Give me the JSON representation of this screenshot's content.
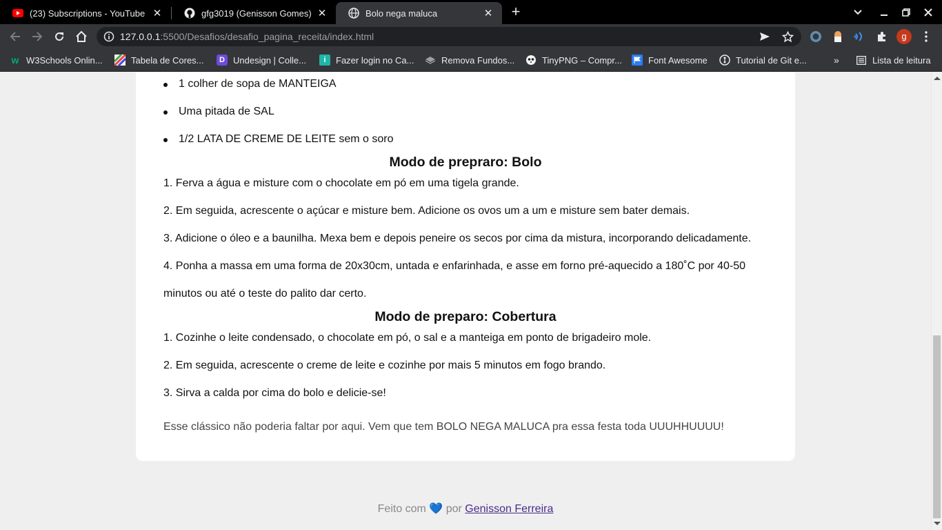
{
  "browser": {
    "tabs": [
      {
        "title": "(23) Subscriptions - YouTube",
        "icon": "youtube-icon",
        "active": false
      },
      {
        "title": "gfg3019 (Genisson Gomes)",
        "icon": "github-icon",
        "active": false
      },
      {
        "title": "Bolo nega maluca",
        "icon": "globe-icon",
        "active": true
      }
    ],
    "new_tab": "+",
    "close": "✕",
    "address": {
      "host": "127.0.0.1",
      "path": ":5500/Desafios/desafio_pagina_receita/index.html"
    },
    "avatar_letter": "g",
    "bookmarks": [
      {
        "label": "W3Schools Onlin...",
        "icon": "w3schools-icon"
      },
      {
        "label": "Tabela de Cores...",
        "icon": "colors-icon"
      },
      {
        "label": "Undesign | Colle...",
        "icon": "undesign-icon"
      },
      {
        "label": "Fazer login no Ca...",
        "icon": "canva-icon"
      },
      {
        "label": "Remova Fundos...",
        "icon": "layers-icon"
      },
      {
        "label": "TinyPNG – Compr...",
        "icon": "panda-icon"
      },
      {
        "label": "Font Awesome",
        "icon": "flag-icon"
      },
      {
        "label": "Tutorial de Git e...",
        "icon": "git-icon"
      }
    ],
    "bookmarks_more": "»",
    "reading_list": "Lista de leitura"
  },
  "page": {
    "ingredients_tail": [
      "1 colher de sopa de MANTEIGA",
      "Uma pitada de SAL",
      "1/2 LATA DE CREME DE LEITE sem o soro"
    ],
    "bolo_heading": "Modo de prepraro: Bolo",
    "bolo_steps": [
      "1. Ferva a água e misture com o chocolate em pó em uma tigela grande.",
      "2. Em seguida, acrescente o açúcar e misture bem. Adicione os ovos um a um e misture sem bater demais.",
      "3. Adicione o óleo e a baunilha. Mexa bem e depois peneire os secos por cima da mistura, incorporando delicadamente.",
      "4. Ponha a massa em uma forma de 20x30cm, untada e enfarinhada, e asse em forno pré-aquecido a 180˚C por 40-50",
      "minutos ou até o teste do palito dar certo."
    ],
    "cobertura_heading": "Modo de preparo: Cobertura",
    "cobertura_steps": [
      "1. Cozinhe o leite condensado, o chocolate em pó, o sal e a manteiga em ponto de brigadeiro mole.",
      "2. Em seguida, acrescente o creme de leite e cozinhe por mais 5 minutos em fogo brando.",
      "3. Sirva a calda por cima do bolo e delicie-se!"
    ],
    "closing": "Esse clássico não poderia faltar por aqui. Vem que tem BOLO NEGA MALUCA pra essa festa toda UUUHHUUUU!",
    "footer": {
      "prefix": "Feito com",
      "heart": "💙",
      "by": "por",
      "author": "Genisson Ferreira"
    }
  }
}
